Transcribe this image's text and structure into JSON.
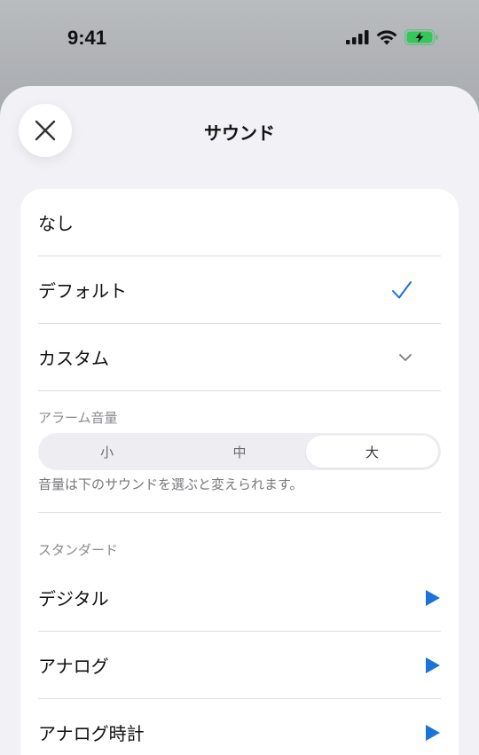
{
  "status_bar": {
    "time": "9:41"
  },
  "sheet": {
    "title": "サウンド"
  },
  "options": [
    {
      "label": "なし"
    },
    {
      "label": "デフォルト",
      "selected": true
    },
    {
      "label": "カスタム"
    }
  ],
  "volume": {
    "label": "アラーム音量",
    "segments": [
      "小",
      "中",
      "大"
    ],
    "selected": "大",
    "helper": "音量は下のサウンドを選ぶと変えられます。"
  },
  "standard": {
    "label": "スタンダード",
    "items": [
      {
        "label": "デジタル"
      },
      {
        "label": "アナログ"
      },
      {
        "label": "アナログ時計"
      }
    ]
  },
  "colors": {
    "accent": "#1a73d9",
    "sheet_bg": "#f1f1f6",
    "battery": "#34c759"
  },
  "icons": {
    "close": "close-icon",
    "check": "checkmark-icon",
    "chevron": "chevron-down-icon",
    "play": "play-icon",
    "signal": "cellular-signal-icon",
    "wifi": "wifi-icon",
    "battery": "battery-charging-icon"
  }
}
